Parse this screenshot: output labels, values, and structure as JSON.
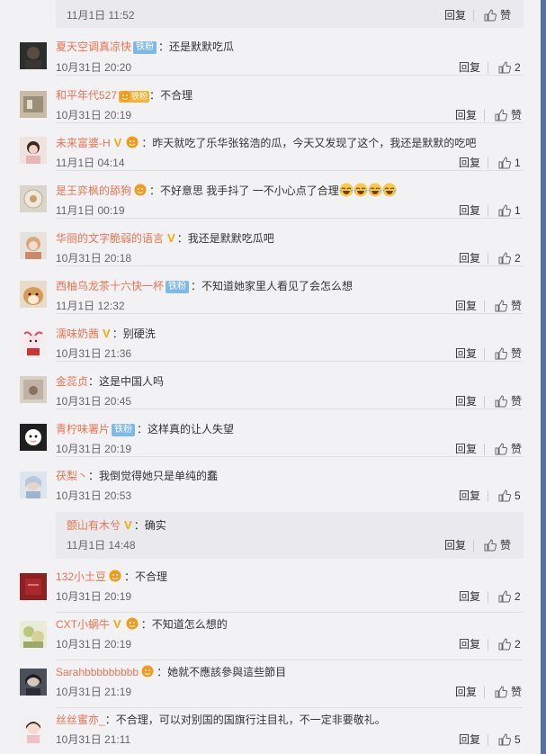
{
  "action_labels": {
    "reply": "回复",
    "like_zero": "赞"
  },
  "badges": {
    "iron_fan": "铁粉",
    "gold_fan": "铁粉"
  },
  "top_reply": {
    "time": "11月1日 11:52",
    "likes": "赞"
  },
  "comments": [
    {
      "nick": "夏天空调真凉快",
      "text": "还是默默吃瓜",
      "time": "10月31日 20:20",
      "likes": "2"
    },
    {
      "nick": "和平年代527",
      "text": "不合理",
      "time": "10月31日 20:19",
      "likes": "赞"
    },
    {
      "nick": "未来富婆-H",
      "text": "昨天就吃了乐华张铭浩的瓜，今天又发现了这个，我还是默默的吃吧",
      "time": "11月1日 04:14",
      "likes": "1"
    },
    {
      "nick": "是王弈枫的舔狗",
      "text": "不好意思 我手抖了 一不小心点了合理",
      "time": "11月1日 00:19",
      "likes": "1"
    },
    {
      "nick": "华丽的文字脆弱的语言",
      "text": "我还是默默吃瓜吧",
      "time": "10月31日 20:18",
      "likes": "2"
    },
    {
      "nick": "西柚乌龙茶十六快一杯",
      "text": "不知道她家里人看见了会怎么想",
      "time": "11月1日 12:32",
      "likes": "赞"
    },
    {
      "nick": "濡味奶茜",
      "text": "别硬洗",
      "time": "10月31日 21:36",
      "likes": "赞"
    },
    {
      "nick": "金蕊贞",
      "text": "这是中国人吗",
      "time": "10月31日 20:45",
      "likes": "赞"
    },
    {
      "nick": "青柠味署片",
      "text": "这样真的让人失望",
      "time": "10月31日 20:19",
      "likes": "赞"
    },
    {
      "nick": "茯梨丶",
      "text": "我倒觉得她只是单纯的蠢",
      "time": "10月31日 20:53",
      "likes": "5"
    },
    {
      "nick": "132小土豆",
      "text": "不合理",
      "time": "10月31日 20:19",
      "likes": "2"
    },
    {
      "nick": "CXT小蜗牛",
      "text": "不知道怎么想的",
      "time": "10月31日 20:19",
      "likes": "2"
    },
    {
      "nick": "Sarahbbbbbbbbb",
      "text": "她就不應該參與這些節目",
      "time": "10月31日 21:19",
      "likes": "赞"
    },
    {
      "nick": "丝丝蜜亦_",
      "text": "不合理，可以对别国的国旗行注目礼，不一定非要敬礼。",
      "time": "10月31日 21:11",
      "likes": "5"
    }
  ],
  "sub_reply": {
    "nick": "颤山有木兮",
    "text": "确实",
    "time": "11月1日 14:48",
    "likes": "赞"
  },
  "colors": {
    "nickname": "#eb7350",
    "vip_badge": "#f5a70b",
    "fan_badge": "#7eb8e6",
    "scrollbar": "#5a6fa8"
  },
  "icons": {
    "like": "thumbs-up-icon",
    "verified": "v-badge-icon",
    "gold_fan": "gold-fan-badge-icon",
    "laugh": "laugh-emoji-icon"
  }
}
